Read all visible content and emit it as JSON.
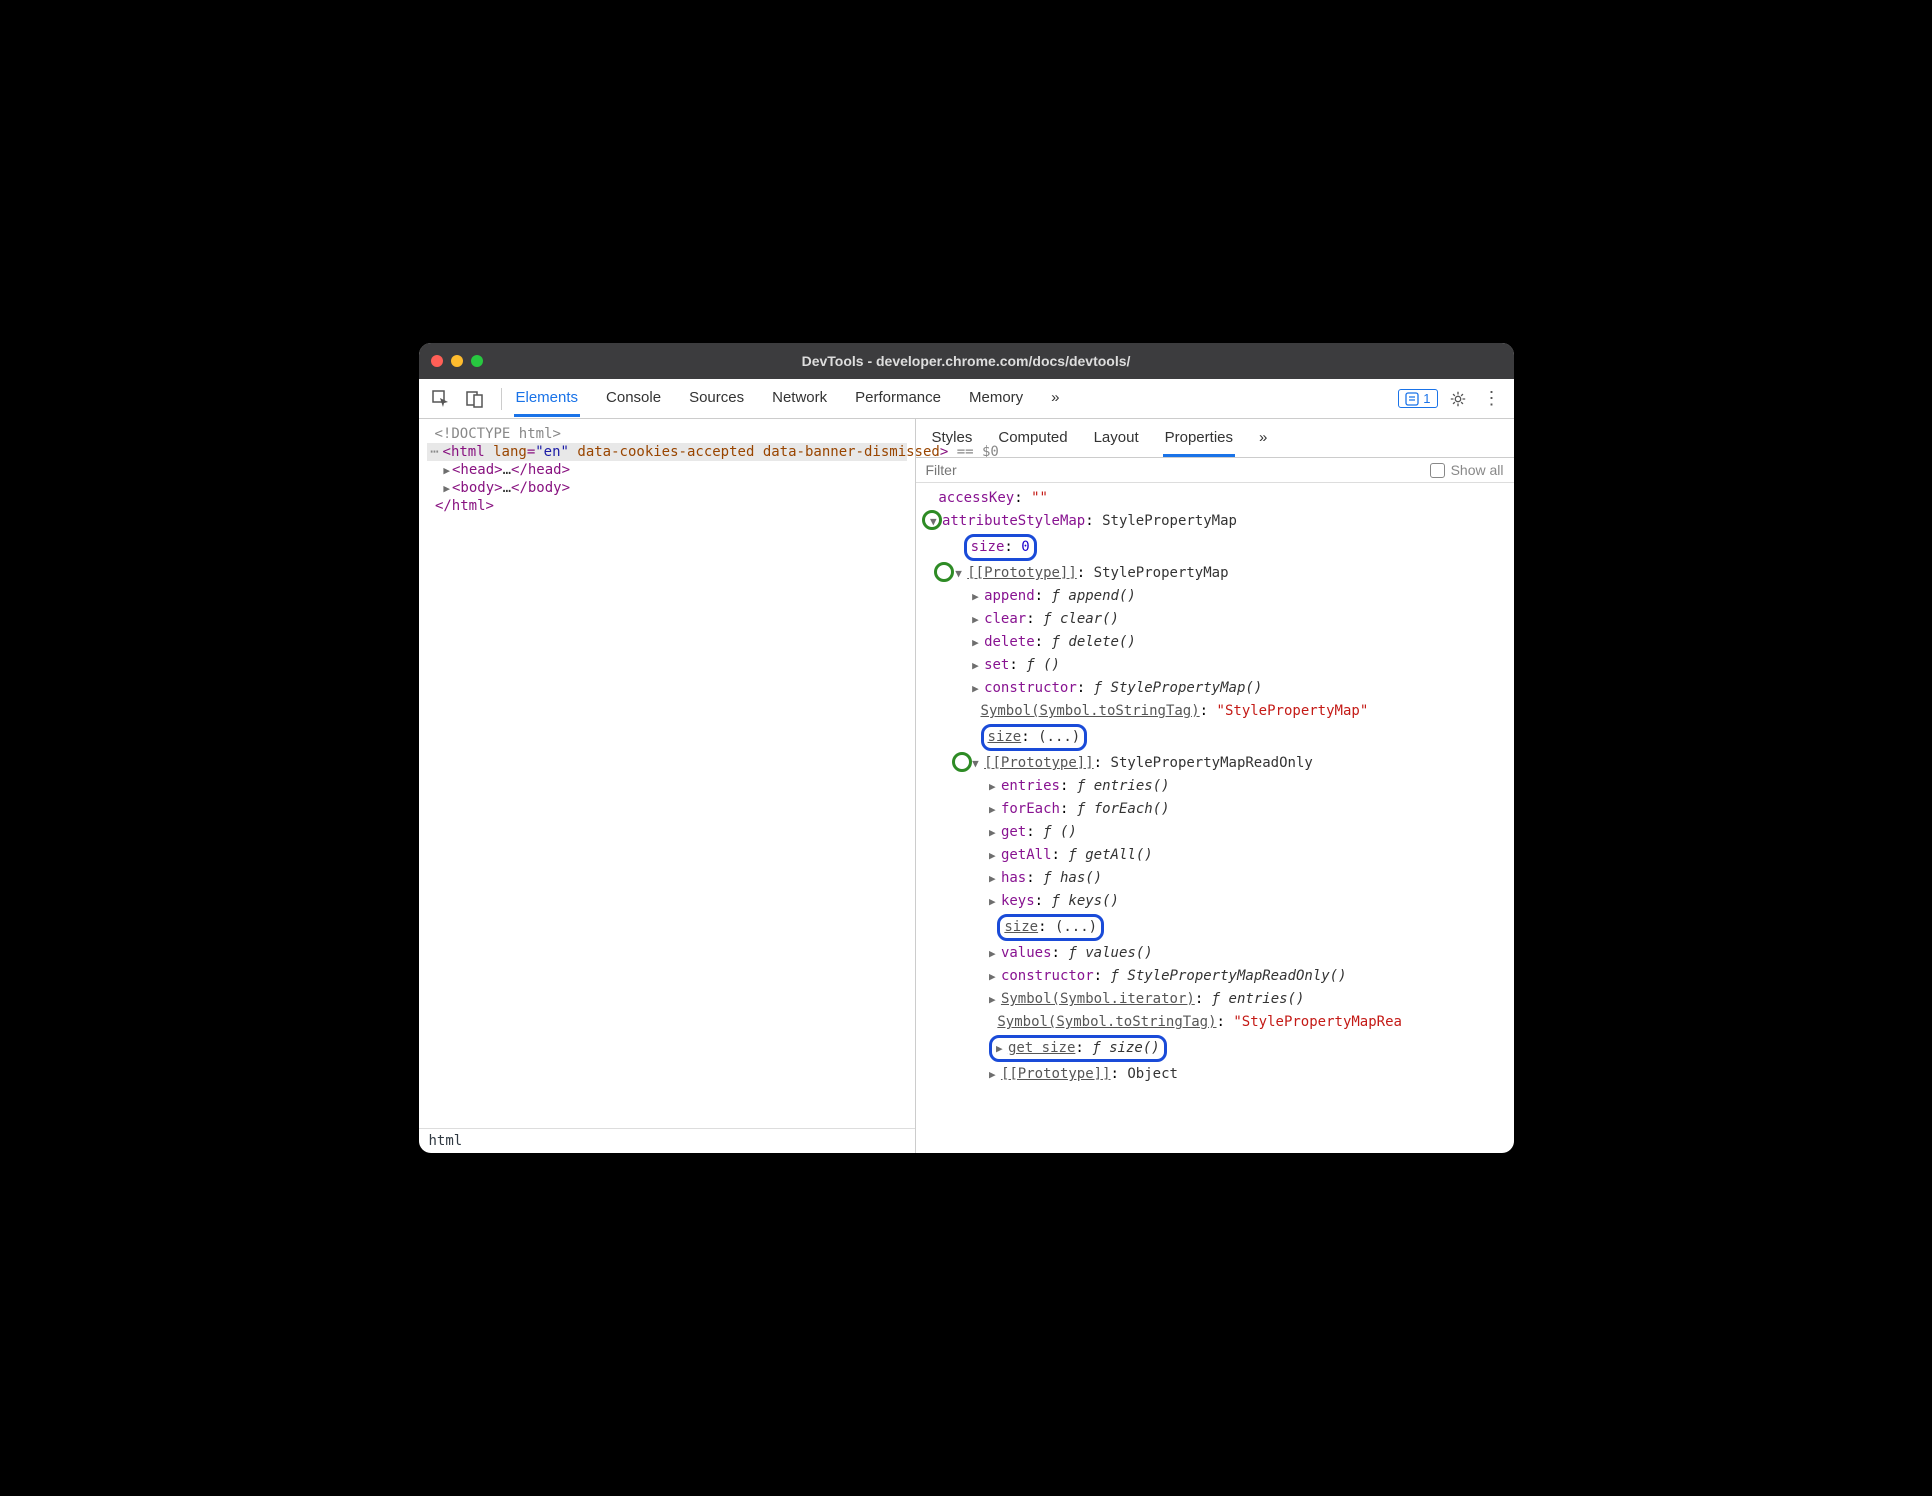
{
  "window": {
    "title": "DevTools - developer.chrome.com/docs/devtools/"
  },
  "toolbar": {
    "tabs": [
      "Elements",
      "Console",
      "Sources",
      "Network",
      "Performance",
      "Memory"
    ],
    "active": "Elements",
    "more": "»",
    "issue_count": "1"
  },
  "dom": {
    "doctype": "<!DOCTYPE html>",
    "html_open": {
      "tag": "html",
      "lang_attr": "lang",
      "lang_val": "\"en\"",
      "attrs": " data-cookies-accepted data-banner-dismissed",
      "suffix": " == $0"
    },
    "head": {
      "open": "head",
      "ell": "…",
      "close": "head"
    },
    "body": {
      "open": "body",
      "ell": "…",
      "close": "body"
    },
    "html_close": "html"
  },
  "crumb": "html",
  "sidebar": {
    "subtabs": [
      "Styles",
      "Computed",
      "Layout",
      "Properties"
    ],
    "active": "Properties",
    "more": "»",
    "filter_placeholder": "Filter",
    "showall": "Show all"
  },
  "props": {
    "access": {
      "k": "accessKey",
      "v": "\"\""
    },
    "asm": {
      "k": "attributeStyleMap",
      "v": "StylePropertyMap"
    },
    "size0": {
      "k": "size",
      "v": "0"
    },
    "proto1": {
      "k": "[[Prototype]]",
      "v": "StylePropertyMap"
    },
    "append": {
      "k": "append",
      "f": "ƒ",
      "fn": "append()"
    },
    "clear": {
      "k": "clear",
      "f": "ƒ",
      "fn": "clear()"
    },
    "delete": {
      "k": "delete",
      "f": "ƒ",
      "fn": "delete()"
    },
    "set": {
      "k": "set",
      "f": "ƒ",
      "fn": "()"
    },
    "ctor1": {
      "k": "constructor",
      "f": "ƒ",
      "fn": "StylePropertyMap()"
    },
    "symtag1": {
      "k": "Symbol(Symbol.toStringTag)",
      "v": "\"StylePropertyMap\""
    },
    "sizeE1": {
      "k": "size",
      "v": "(...)"
    },
    "proto2": {
      "k": "[[Prototype]]",
      "v": "StylePropertyMapReadOnly"
    },
    "entries": {
      "k": "entries",
      "f": "ƒ",
      "fn": "entries()"
    },
    "forEach": {
      "k": "forEach",
      "f": "ƒ",
      "fn": "forEach()"
    },
    "get": {
      "k": "get",
      "f": "ƒ",
      "fn": "()"
    },
    "getAll": {
      "k": "getAll",
      "f": "ƒ",
      "fn": "getAll()"
    },
    "has": {
      "k": "has",
      "f": "ƒ",
      "fn": "has()"
    },
    "keys": {
      "k": "keys",
      "f": "ƒ",
      "fn": "keys()"
    },
    "sizeE2": {
      "k": "size",
      "v": "(...)"
    },
    "values": {
      "k": "values",
      "f": "ƒ",
      "fn": "values()"
    },
    "ctor2": {
      "k": "constructor",
      "f": "ƒ",
      "fn": "StylePropertyMapReadOnly()"
    },
    "symiter": {
      "k": "Symbol(Symbol.iterator)",
      "f": "ƒ",
      "fn": "entries()"
    },
    "symtag2": {
      "k": "Symbol(Symbol.toStringTag)",
      "v": "\"StylePropertyMapRea"
    },
    "getsize": {
      "k": "get size",
      "f": "ƒ",
      "fn": "size()"
    },
    "proto3": {
      "k": "[[Prototype]]",
      "v": "Object"
    }
  }
}
